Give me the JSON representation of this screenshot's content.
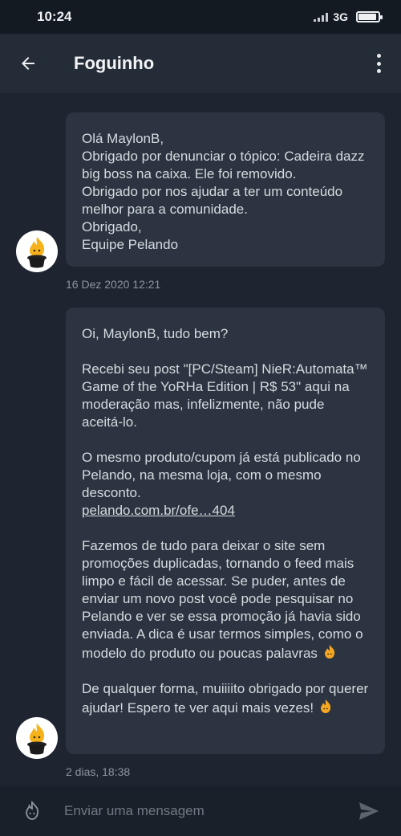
{
  "status_bar": {
    "time": "10:24",
    "network": "3G",
    "battery_level": 0.85
  },
  "header": {
    "title": "Foguinho"
  },
  "messages": [
    {
      "lines": [
        "Olá MaylonB,",
        "Obrigado por denunciar o tópico: Cadeira dazz big boss na caixa.  Ele foi removido.",
        "Obrigado por nos ajudar a ter um conteúdo melhor para a comunidade.",
        "Obrigado,",
        "Equipe Pelando"
      ],
      "timestamp": "16 Dez 2020 12:21"
    },
    {
      "greeting": "Oi, MaylonB, tudo bem?",
      "para1": "Recebi seu post \"[PC/Steam] NieR:Automata™ Game of the YoRHa Edition | R$ 53\" aqui na moderação mas, infelizmente, não pude aceitá-lo.",
      "para2": "O mesmo produto/cupom já está publicado no Pelando, na mesma loja, com o mesmo desconto.",
      "link": "pelando.com.br/ofe…404",
      "para3": "Fazemos de tudo para deixar o site sem promoções duplicadas, tornando o feed mais limpo e fácil de acessar.  Se puder, antes de enviar um novo post você pode pesquisar no Pelando e ver se essa promoção já havia sido enviada. A dica é usar termos simples, como o modelo do produto ou poucas palavras",
      "para4": "De qualquer forma, muiiiito obrigado por querer ajudar! Espero te ver aqui mais vezes!",
      "timestamp": "2 dias, 18:38"
    }
  ],
  "composer": {
    "placeholder": "Enviar uma mensagem"
  },
  "colors": {
    "background": "#1e2530",
    "bubble": "#2b3440",
    "appbar": "#242c37"
  },
  "icons": {
    "back": "arrow-left-icon",
    "more": "more-vert-icon",
    "emoji": "flame-emoji-icon",
    "send": "send-icon"
  }
}
